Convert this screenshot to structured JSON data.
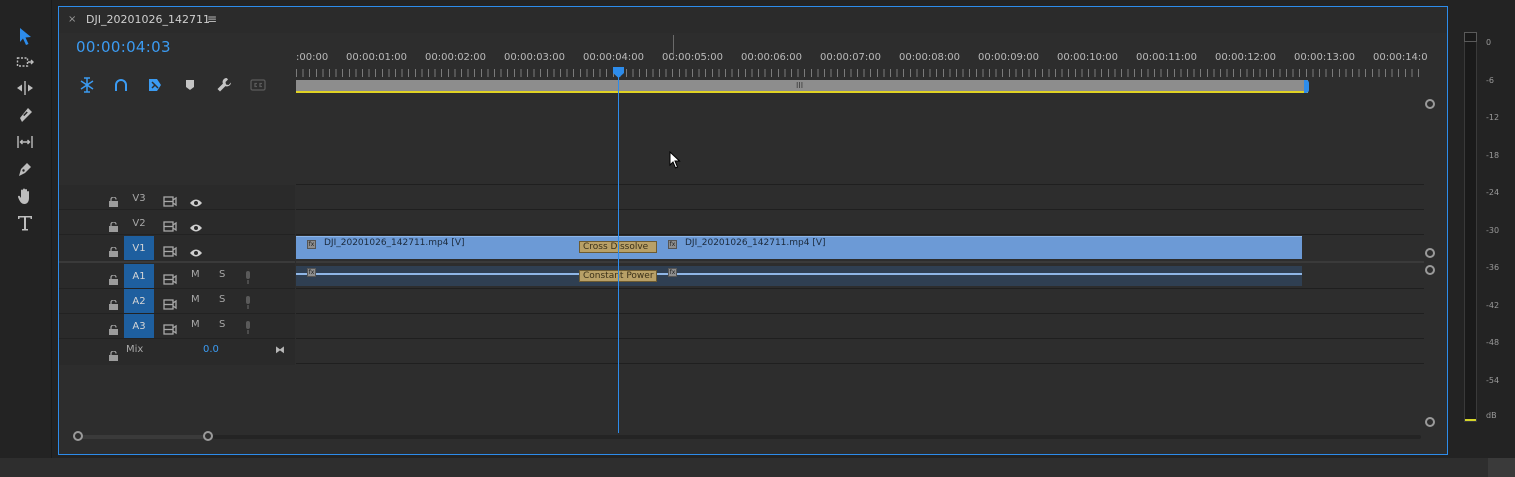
{
  "tab": {
    "close": "×",
    "title": "DJI_20201026_142711",
    "menu": "≡"
  },
  "timecode": "00:00:04:03",
  "ruler": {
    "labels": [
      ":00:00",
      "00:00:01:00",
      "00:00:02:00",
      "00:00:03:00",
      "00:00:04:00",
      "00:00:05:00",
      "00:00:06:00",
      "00:00:07:00",
      "00:00:08:00",
      "00:00:09:00",
      "00:00:10:00",
      "00:00:11:00",
      "00:00:12:00",
      "00:00:13:00",
      "00:00:14:0"
    ],
    "work_grip": "III"
  },
  "tools": [
    "selection-tool-icon",
    "track-select-icon",
    "ripple-edit-icon",
    "razor-icon",
    "slip-icon",
    "pen-icon",
    "hand-icon",
    "type-icon"
  ],
  "timeline_controls": [
    "snap-icon",
    "linked-selection-icon",
    "add-marker-icon",
    "marker-icon",
    "wrench-icon",
    "captions-icon"
  ],
  "tracks": {
    "video": [
      {
        "label": "V3",
        "selected": false
      },
      {
        "label": "V2",
        "selected": false
      },
      {
        "label": "V1",
        "selected": true
      }
    ],
    "audio": [
      {
        "label": "A1",
        "m": "M",
        "s": "S",
        "selected": true
      },
      {
        "label": "A2",
        "m": "M",
        "s": "S",
        "selected": true
      },
      {
        "label": "A3",
        "m": "M",
        "s": "S",
        "selected": true
      }
    ],
    "mix": {
      "label": "Mix",
      "value": "0.0",
      "icon": "⧓"
    }
  },
  "clips": {
    "video1_name": "DJI_20201026_142711.mp4 [V]",
    "video2_name": "DJI_20201026_142711.mp4 [V]",
    "video_transition": "Cross Dissolve",
    "audio_transition": "Constant Power",
    "fx": "fx"
  },
  "meter": {
    "labels": [
      "0",
      "-6",
      "-12",
      "-18",
      "-24",
      "-30",
      "-36",
      "-42",
      "-48",
      "-54",
      "dB"
    ]
  },
  "colors": {
    "accent": "#2d8ceb",
    "clip_video": "#6c9ad6",
    "transition": "#b8a067",
    "work_area": "#e0d224"
  }
}
